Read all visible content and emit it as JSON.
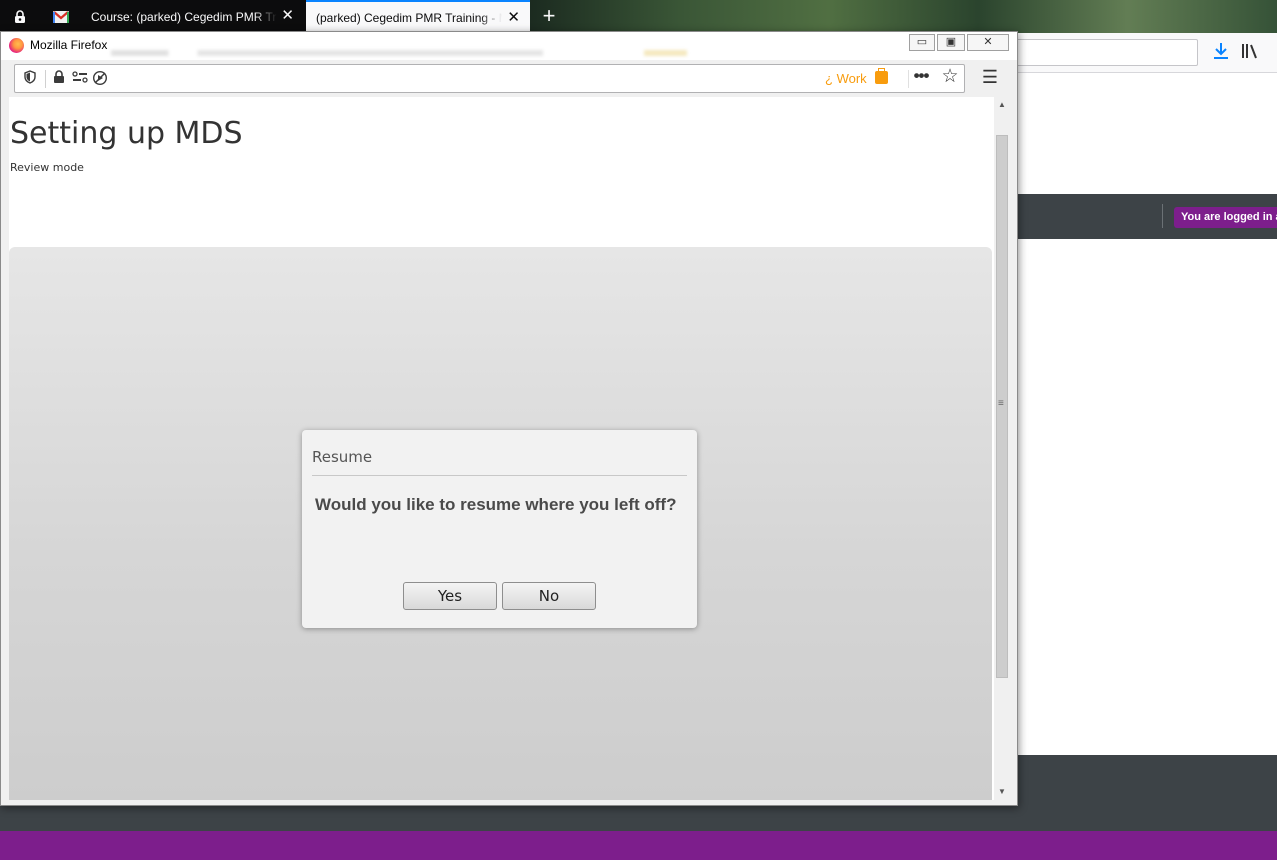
{
  "background_browser": {
    "tabs": [
      {
        "label": "Course: (parked) Cegedim PMR Training"
      },
      {
        "label": "(parked) Cegedim PMR Training - Moodle"
      }
    ],
    "new_tab_label": "+",
    "close_glyph": "✕",
    "logged_in_badge": "You are logged in as",
    "accent_color": "#7d1e8c"
  },
  "popup": {
    "window_title": "Mozilla Firefox",
    "urlbar": {
      "container_label": "Work",
      "container_prefix": "¿"
    },
    "window_controls": {
      "minimize": "▭",
      "maximize": "▣",
      "close": "✕"
    },
    "page": {
      "title": "Setting up MDS",
      "mode_label": "Review mode"
    },
    "dialog": {
      "title": "Resume",
      "message": "Would you like to resume where you left off?",
      "yes_label": "Yes",
      "no_label": "No"
    }
  },
  "icons": {
    "private": "private-browsing-icon",
    "gmail": "gmail-icon",
    "download": "download-icon",
    "library": "library-icon",
    "shield": "tracking-protection-shield-icon",
    "lock": "lock-icon",
    "permissions": "permissions-icon",
    "autoplay": "autoplay-blocked-icon",
    "page_actions": "page-actions-icon",
    "bookmark": "bookmark-star-icon",
    "menu": "hamburger-menu-icon"
  }
}
